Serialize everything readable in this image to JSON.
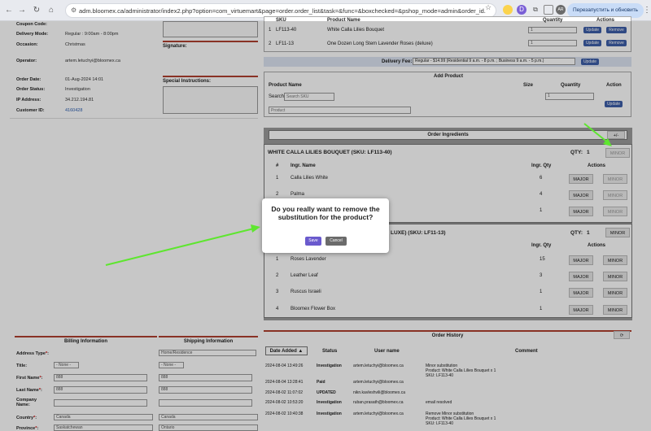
{
  "browser": {
    "url": "adm.bloomex.ca/administrator/index2.php?option=com_virtuemart&page=order.order_list&task=&func=&boxchecked=&pshop_mode=admin&order_id...",
    "relaunch_label": "Перезапустить и обновить",
    "profile": "AR"
  },
  "order_info": [
    {
      "label": "Coupon Code:",
      "value": ""
    },
    {
      "label": "Delivery Mode:",
      "value": "Regular : 9:00am - 8:00pm"
    },
    {
      "label": "Occasion:",
      "value": "Christmas"
    },
    {
      "label": "Operator:",
      "value": "artem.letuchyi@bloomex.ca"
    },
    {
      "label": "Order Date:",
      "value": "01-Aug-2024 14:01"
    },
    {
      "label": "Order Status:",
      "value": "Investigation"
    },
    {
      "label": "IP Address:",
      "value": "34.212.194.81"
    },
    {
      "label": "Customer ID:",
      "value": "4160428"
    }
  ],
  "signature_label": "Signature:",
  "special_instructions_label": "Special Instructions:",
  "items_table": {
    "headers": [
      "#",
      "SKU",
      "Product Name",
      "Quantity",
      "Actions"
    ],
    "rows": [
      {
        "num": "1",
        "sku": "LF113-40",
        "name": "White Calla Lilies Bouquet",
        "qty": "1"
      },
      {
        "num": "2",
        "sku": "LF11-13",
        "name": "One Dozen Long Stem Lavender Roses (deluxe)",
        "qty": "1"
      }
    ],
    "update_label": "Update",
    "remove_label": "Remove"
  },
  "delivery_fee": {
    "label": "Delivery Fee:",
    "selected": "Regular - $14.99 (Residential 9 a.m. - 8 p.m. ; Business 9 a.m. - 5 p.m.)",
    "update_label": "Update"
  },
  "add_product": {
    "title": "Add Product",
    "headers": [
      "Product Name",
      "Size",
      "Quantity",
      "Action"
    ],
    "search_label": "Search:",
    "search_placeholder": "Search SKU",
    "product_placeholder": "Product",
    "qty": "1",
    "update_label": "Update"
  },
  "ingredients": {
    "title": "Order Ingredients",
    "toggle": "+/-",
    "qty_label": "QTY:",
    "headers": [
      "#",
      "Ingr. Name",
      "Ingr. Qty",
      "Actions"
    ],
    "major_label": "MAJOR",
    "minor_label": "MINOR",
    "product1": {
      "title": "WHITE CALLA LILIES BOUQUET (SKU: LF113-40)",
      "qty": "1",
      "rows": [
        {
          "num": "1",
          "name": "Calla Lilies White",
          "qty": "6"
        },
        {
          "num": "2",
          "name": "Palma",
          "qty": "4"
        },
        {
          "num": "",
          "name": "",
          "qty": "1"
        }
      ]
    },
    "product2": {
      "title_visible": "LUXE) (SKU: LF11-13)",
      "qty": "1",
      "rows": [
        {
          "num": "1",
          "name": "Roses Lavender",
          "qty": "15"
        },
        {
          "num": "2",
          "name": "Leather Leaf",
          "qty": "3"
        },
        {
          "num": "3",
          "name": "Ruscus Israeli",
          "qty": "1"
        },
        {
          "num": "4",
          "name": "Bloomex Flower Box",
          "qty": "1"
        }
      ]
    }
  },
  "dialog": {
    "message": "Do you really want to remove the substitution for the product?",
    "save": "Save",
    "cancel": "Cancel"
  },
  "billing": {
    "title": "Billing Information",
    "shipping_title": "Shipping Information",
    "address_type_label": "Address Type",
    "shipping_address_type": "Home/Residence",
    "title_label": "Title:",
    "title_value": "- None -",
    "first_name_label": "First Name",
    "first_name": "888",
    "last_name_label": "Last Name",
    "last_name": "888",
    "company_label": "Company Name:",
    "country_label": "Country",
    "country": "Canada",
    "province_label": "Province",
    "billing_province": "Saskatchewan",
    "shipping_province": "Ontario",
    "required_mark": "*",
    "colon": ":"
  },
  "history": {
    "title": "Order History",
    "headers": [
      "Date Added ▲",
      "Status",
      "User name",
      "Comment"
    ],
    "rows": [
      {
        "date": "2024-08-04 13:49:26",
        "status": "Investigation",
        "user": "artem.letuchyi@bloomex.ca",
        "comment": "Minor substitution\nProduct: White Calla Lilies Bouquet x 1\nSKU: LF113-40"
      },
      {
        "date": "2024-08-04 13:28:41",
        "status": "Paid",
        "user": "artem.letuchyi@bloomex.ca",
        "comment": ""
      },
      {
        "date": "2024-08-02 11:07:02",
        "status": "UPDATED",
        "user": "nikn.kavleshvili@bloomex.ca",
        "comment": ""
      },
      {
        "date": "2024-08-02 10:53:20",
        "status": "Investigation",
        "user": "ruban.prasath@bloomex.ca",
        "comment": "email resolved"
      },
      {
        "date": "2024-08-02 10:40:38",
        "status": "Investigation",
        "user": "artem.letuchyi@bloomex.ca",
        "comment": "Remove Minor substitution\nProduct: White Calla Lilies Bouquet x 1\nSKU: LF113-40"
      }
    ]
  },
  "colors": {
    "accent": "#3d5ea8",
    "arrow": "#5ee62f",
    "section_rule": "#b04030"
  }
}
